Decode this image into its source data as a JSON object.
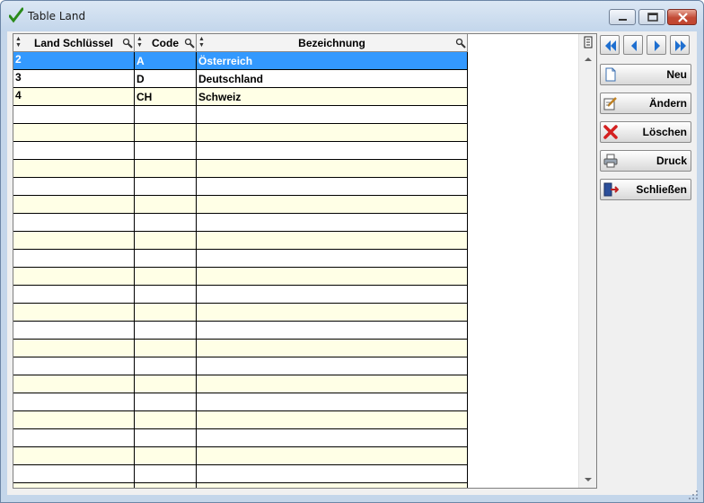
{
  "window": {
    "title": "Table Land"
  },
  "table": {
    "columns": [
      {
        "label": "Land Schlüssel"
      },
      {
        "label": "Code"
      },
      {
        "label": "Bezeichnung"
      }
    ],
    "rows": [
      {
        "key": "2",
        "code": "A",
        "name": "Österreich",
        "selected": true
      },
      {
        "key": "3",
        "code": "D",
        "name": "Deutschland",
        "selected": false
      },
      {
        "key": "4",
        "code": "CH",
        "name": "Schweiz",
        "selected": false
      }
    ],
    "empty_rows": 22
  },
  "actions": {
    "new_label": "Neu",
    "edit_label": "Ändern",
    "delete_label": "Löschen",
    "print_label": "Druck",
    "close_label": "Schließen"
  },
  "icons": {
    "title": "checkmark-icon",
    "nav": [
      "first-record-icon",
      "previous-record-icon",
      "next-record-icon",
      "last-record-icon"
    ],
    "new": "new-document-icon",
    "edit": "edit-icon",
    "delete": "delete-x-icon",
    "print": "printer-icon",
    "close": "exit-door-icon"
  },
  "colors": {
    "selected_row": "#3399ff",
    "odd_row": "#ffffe6",
    "close_button": "#c2452e"
  }
}
